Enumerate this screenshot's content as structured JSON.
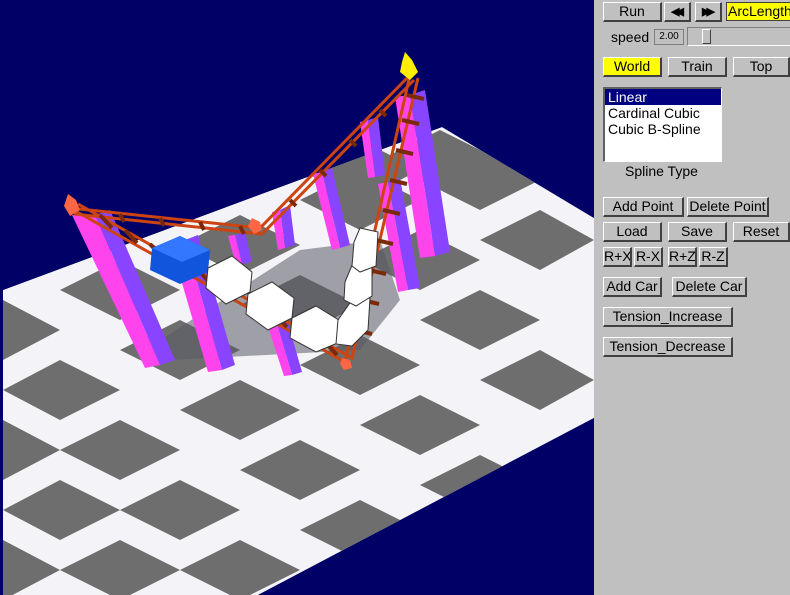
{
  "viewport": {
    "colors": {
      "background": "#000066",
      "floor_light": "#f4f4f8",
      "floor_dark": "#6e6e6e",
      "pillar_front": "#ff44ee",
      "pillar_side": "#8844ff",
      "track": "#cc4411",
      "car": "#ffffff",
      "engine": "#1155dd",
      "control_point": "#ff6644",
      "selected_point": "#ffee00"
    }
  },
  "toolbar": {
    "run_label": "Run",
    "rewind_icon": "rewind-icon",
    "forward_icon": "fast-forward-icon",
    "arclength_label": "ArcLength"
  },
  "speed": {
    "label": "speed",
    "value": "2.00",
    "level": 0.15
  },
  "views": {
    "world": "World",
    "train": "Train",
    "top": "Top",
    "selected": "World"
  },
  "spline": {
    "options": [
      "Linear",
      "Cardinal Cubic",
      "Cubic B-Spline"
    ],
    "selected": "Linear",
    "caption": "Spline Type"
  },
  "points": {
    "add": "Add Point",
    "delete": "Delete Point"
  },
  "file": {
    "load": "Load",
    "save": "Save",
    "reset": "Reset"
  },
  "rotate": {
    "rx_plus": "R+X",
    "rx_minus": "R-X",
    "rz_plus": "R+Z",
    "rz_minus": "R-Z"
  },
  "cars": {
    "add": "Add Car",
    "delete": "Delete Car"
  },
  "tension": {
    "increase": "Tension_Increase",
    "decrease": "Tension_Decrease"
  }
}
